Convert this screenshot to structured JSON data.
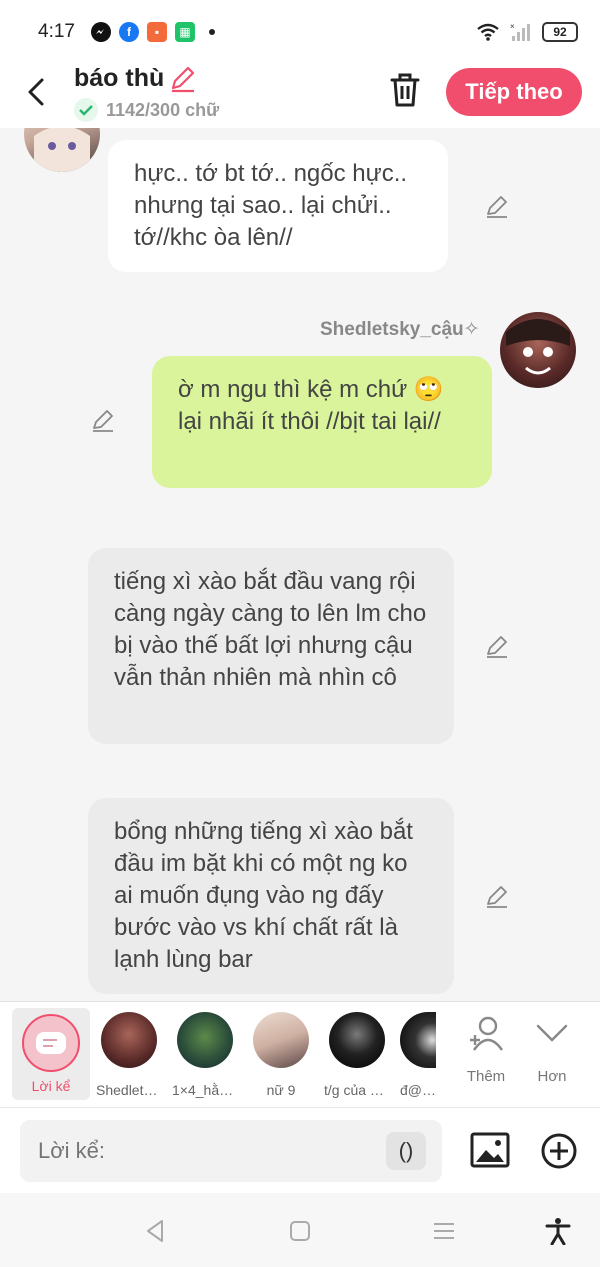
{
  "status": {
    "time": "4:17",
    "battery": "92"
  },
  "header": {
    "title": "báo thù",
    "word_count": "1142/300 chữ",
    "next_label": "Tiếp theo",
    "accent": "#f04e6c"
  },
  "messages": [
    {
      "type": "character",
      "text": "hực.. tớ bt tớ.. ngốc hực.. nhưng tại sao.. lại chửi.. tớ//khc òa lên//"
    },
    {
      "type": "self",
      "name": "Shedletsky_cậu✧",
      "text": "ờ m ngu thì kệ m chứ 🙄 lại nhãi ít thôi //bịt tai lại//"
    },
    {
      "type": "narration",
      "text": "tiếng xì xào bắt đầu vang rội càng ngày càng to lên lm cho bị vào thế bất lợi nhưng cậu vẫn thản nhiên mà nhìn cô"
    },
    {
      "type": "narration",
      "text": "bổng những tiếng xì xào bắt đầu im bặt khi có một ng ko ai muốn đụng vào ng đấy bước vào vs khí chất rất là lạnh lùng bar"
    }
  ],
  "characters": {
    "narration_label": "Lời kể",
    "items": [
      "Shedletsk...",
      "1×4_hằn✧",
      "nữ 9",
      "t/g của bộ...",
      "đ@ nh"
    ],
    "more_add": "Thêm",
    "more": "Hơn"
  },
  "composer": {
    "placeholder": "Lời kể:",
    "paren": "()"
  }
}
